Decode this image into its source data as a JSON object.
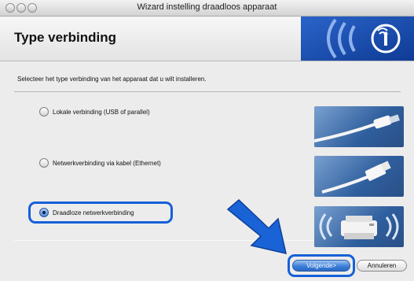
{
  "window": {
    "title": "Wizard instelling draadloos apparaat"
  },
  "header": {
    "title": "Type verbinding"
  },
  "instruction": "Selecteer het type verbinding van het apparaat dat u wilt installeren.",
  "options": [
    {
      "label": "Lokale verbinding (USB of parallel)",
      "selected": false,
      "icon": "usb-cable-icon"
    },
    {
      "label": "Netwerkverbinding via kabel (Ethernet)",
      "selected": false,
      "icon": "ethernet-cable-icon"
    },
    {
      "label": "Draadloze netwerkverbinding",
      "selected": true,
      "icon": "wireless-printer-icon"
    }
  ],
  "buttons": {
    "next": "Volgende>",
    "cancel": "Annuleren"
  },
  "colors": {
    "accent": "#1660d8",
    "panel": "#ececec",
    "thumb": "#3a6db0"
  }
}
